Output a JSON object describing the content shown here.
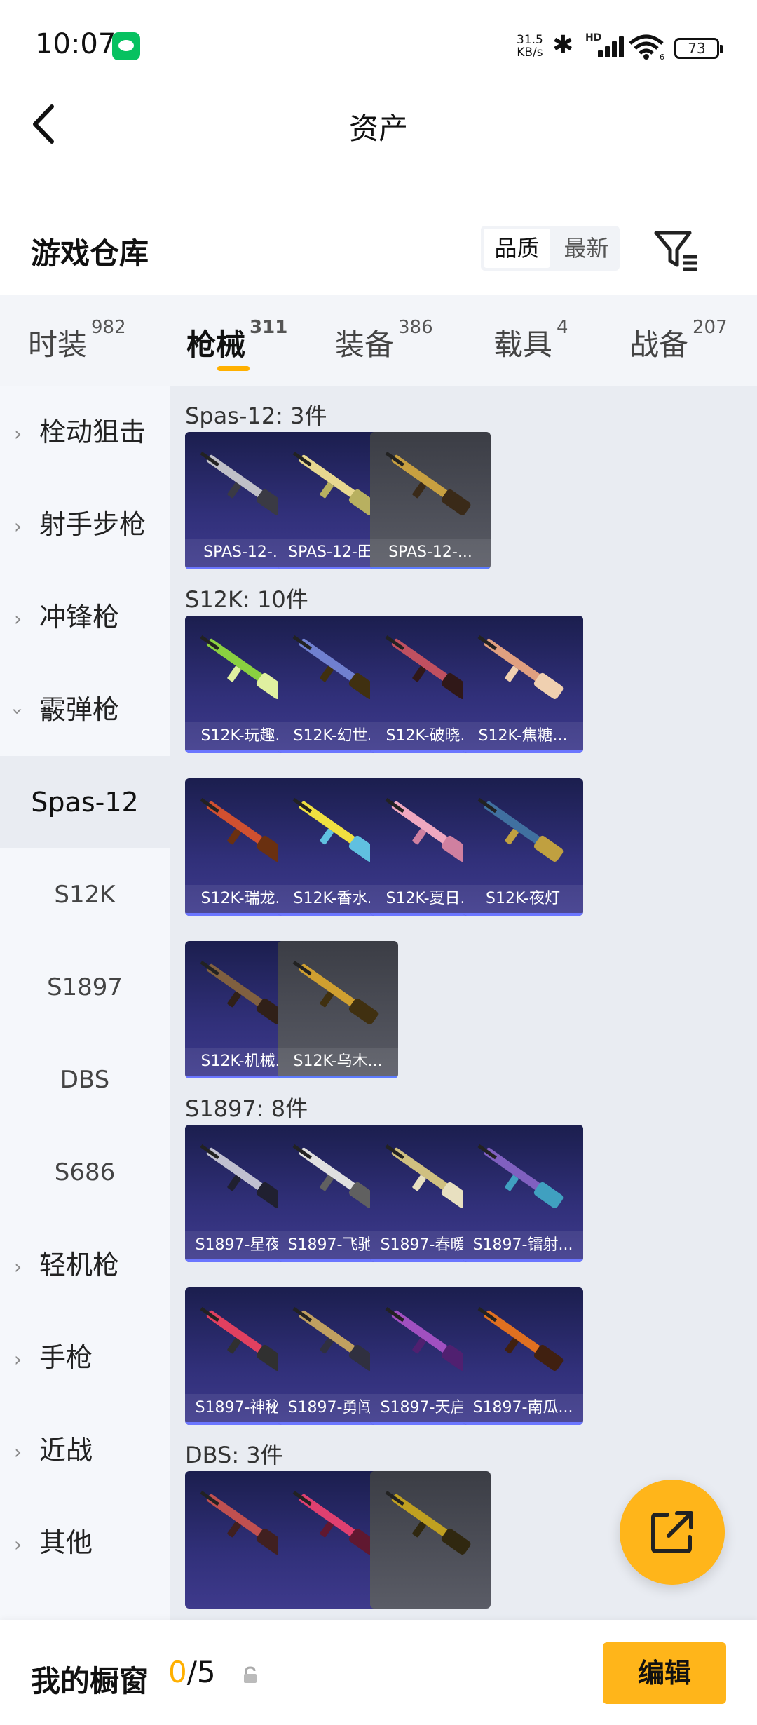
{
  "status_bar": {
    "time": "10:07",
    "net_speed_value": "31.5",
    "net_speed_unit": "KB/s",
    "hd_label": "HD",
    "wifi_label": "6",
    "battery": "73"
  },
  "header": {
    "title": "资产"
  },
  "warehouse": {
    "title": "游戏仓库",
    "sort_options": [
      "品质",
      "最新"
    ],
    "selected_sort": "品质"
  },
  "tabs": [
    {
      "label": "时装",
      "count": "982"
    },
    {
      "label": "枪械",
      "count": "311"
    },
    {
      "label": "装备",
      "count": "386"
    },
    {
      "label": "载具",
      "count": "4"
    },
    {
      "label": "战备",
      "count": "207"
    }
  ],
  "sidebar": {
    "categories": [
      {
        "label": "栓动狙击"
      },
      {
        "label": "射手步枪"
      },
      {
        "label": "冲锋枪"
      },
      {
        "label": "霰弹枪"
      },
      {
        "label": "轻机枪"
      },
      {
        "label": "手枪"
      },
      {
        "label": "近战"
      },
      {
        "label": "其他"
      }
    ],
    "subcategories": [
      {
        "label": "Spas-12"
      },
      {
        "label": "S12K"
      },
      {
        "label": "S1897"
      },
      {
        "label": "DBS"
      },
      {
        "label": "S686"
      }
    ]
  },
  "groups": [
    {
      "title": "Spas-12: 3件",
      "items": [
        "SPAS-12-...",
        "SPAS-12-田...",
        "SPAS-12-..."
      ]
    },
    {
      "title": "S12K: 10件",
      "items": [
        "S12K-玩趣...",
        "S12K-幻世...",
        "S12K-破晓...",
        "S12K-焦糖...",
        "S12K-瑞龙...",
        "S12K-香水...",
        "S12K-夏日...",
        "S12K-夜灯",
        "S12K-机械...",
        "S12K-乌木..."
      ]
    },
    {
      "title": "S1897: 8件",
      "items": [
        "S1897-星夜...",
        "S1897-飞驰...",
        "S1897-春暖...",
        "S1897-镭射...",
        "S1897-神秘...",
        "S1897-勇闯...",
        "S1897-天启...",
        "S1897-南瓜..."
      ]
    },
    {
      "title": "DBS: 3件",
      "items": [
        "",
        "",
        ""
      ]
    }
  ],
  "bottom_bar": {
    "label": "我的橱窗",
    "current": "0",
    "total": "/5",
    "edit_label": "编辑"
  },
  "colors": {
    "accent": "#ffb51a",
    "tile_dark": "#2a2a6e",
    "tile_gray": "#55575f"
  }
}
